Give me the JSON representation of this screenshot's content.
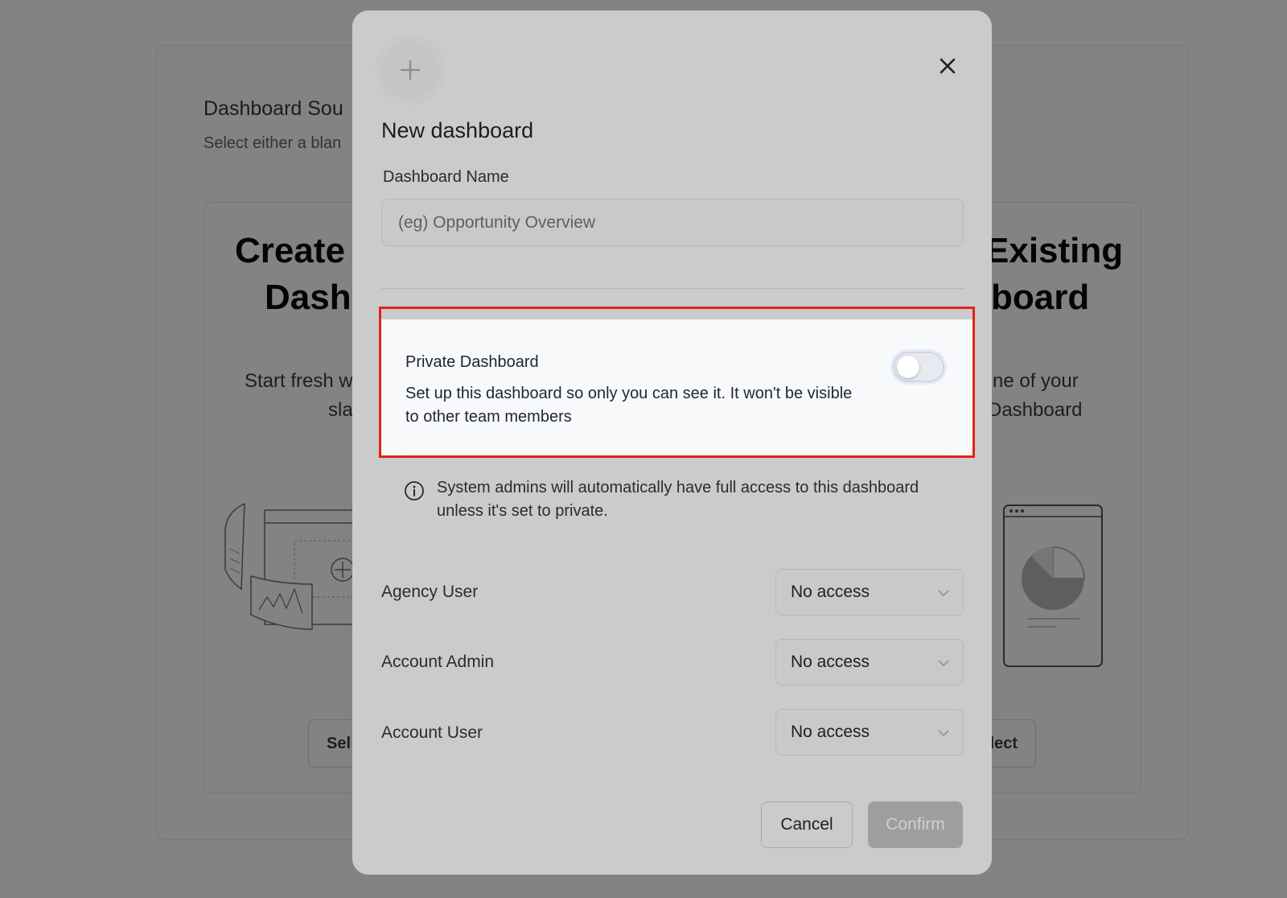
{
  "background": {
    "section_title": "Dashboard Sou",
    "section_subtitle": "Select either a blan",
    "left_card": {
      "heading_line1": "Create a",
      "heading_line2": "Dashb",
      "body_line1": "Start fresh w",
      "body_line2": "sla",
      "button": "Sel"
    },
    "right_card": {
      "heading_line1": "Existing",
      "heading_line2": "board",
      "body_line1": "ne of your",
      "body_line2": "Dashboard",
      "button": "lect"
    }
  },
  "modal": {
    "title": "New dashboard",
    "name_field": {
      "label": "Dashboard Name",
      "value": "",
      "placeholder": "(eg) Opportunity Overview"
    },
    "private": {
      "label": "Private Dashboard",
      "description": "Set up this dashboard so only you can see it. It won't be visible to other team members",
      "enabled": false
    },
    "info_text": "System admins will automatically have full access to this dashboard unless it's set to private.",
    "roles": [
      {
        "label": "Agency User",
        "access": "No access"
      },
      {
        "label": "Account Admin",
        "access": "No access"
      },
      {
        "label": "Account User",
        "access": "No access"
      }
    ],
    "cancel_label": "Cancel",
    "confirm_label": "Confirm"
  },
  "colors": {
    "overlay": "#838383",
    "modal_bg": "#cbcbcb",
    "highlight": "#e0231b",
    "confirm_disabled": "#9e9e9e"
  },
  "icons": [
    "plus-icon",
    "close-icon",
    "info-icon",
    "chevron-down-icon"
  ]
}
